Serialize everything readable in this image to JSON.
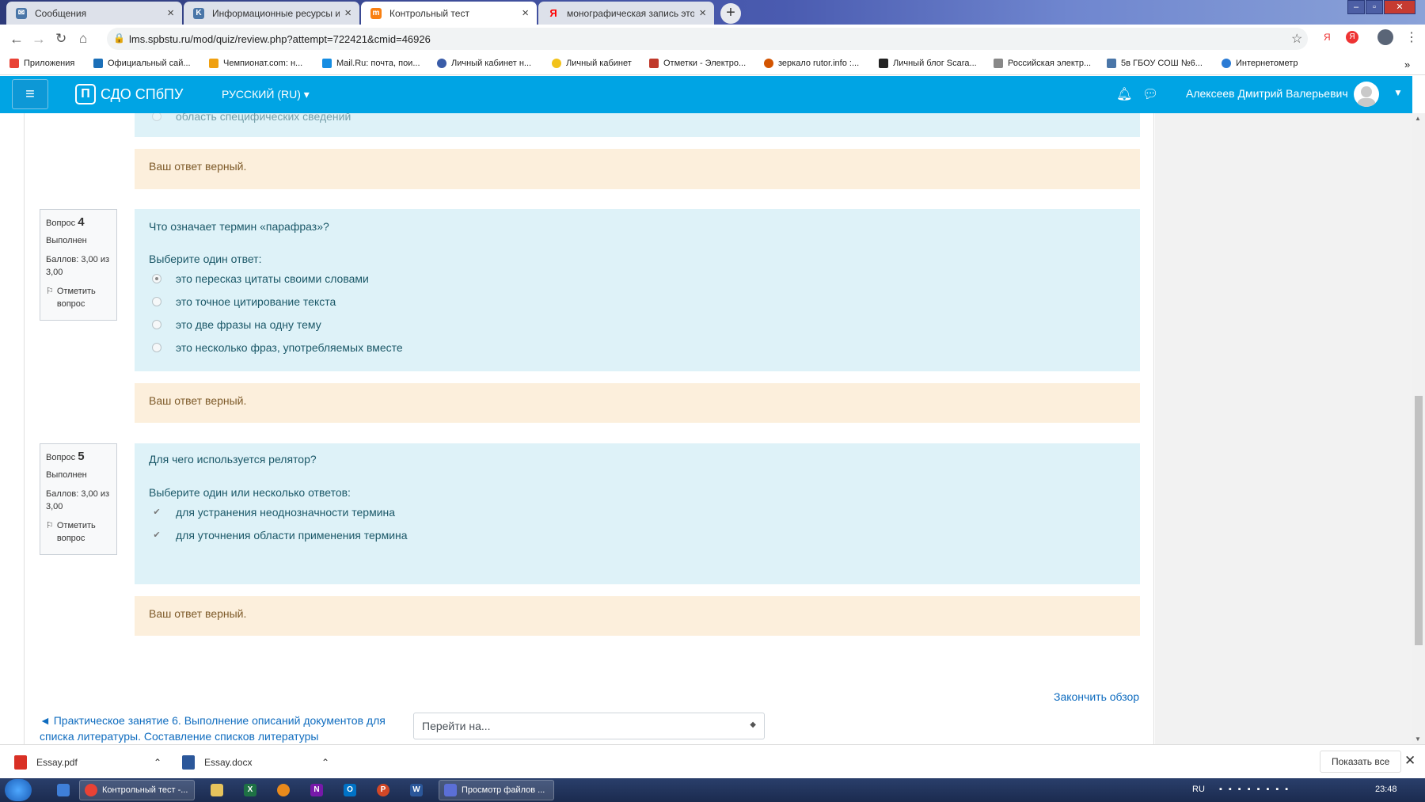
{
  "browser": {
    "tabs": [
      {
        "title": "Сообщения",
        "icon": "vk-message-icon",
        "color": "#4a76a8",
        "active": false
      },
      {
        "title": "Информационные ресурсы и т",
        "icon": "vk-icon",
        "color": "#4a76a8",
        "active": false
      },
      {
        "title": "Контрольный тест",
        "icon": "moodle-icon",
        "color": "#f98012",
        "active": true
      },
      {
        "title": "монографическая запись это —",
        "icon": "yandex-icon",
        "color": "#ff0000",
        "active": false
      }
    ],
    "url": "lms.spbstu.ru/mod/quiz/review.php?attempt=722421&cmid=46926",
    "bookmarks": [
      {
        "label": "Приложения",
        "color": "#e94235"
      },
      {
        "label": "Официальный сай...",
        "color": "#1b6fb8"
      },
      {
        "label": "Чемпионат.com: н...",
        "color": "#f0a010"
      },
      {
        "label": "Mail.Ru: почта, пои...",
        "color": "#168de2"
      },
      {
        "label": "Личный кабинет н...",
        "color": "#3a5ca8"
      },
      {
        "label": "Личный кабинет",
        "color": "#f2c21a"
      },
      {
        "label": "Отметки - Электро...",
        "color": "#c0392b"
      },
      {
        "label": "зеркало rutor.info :...",
        "color": "#d35400"
      },
      {
        "label": "Личный блог Scara...",
        "color": "#222222"
      },
      {
        "label": "Российская электр...",
        "color": "#888888"
      },
      {
        "label": "5в ГБОУ СОШ №6...",
        "color": "#4a76a8"
      },
      {
        "label": "Интернетометр",
        "color": "#2a7bd5"
      }
    ]
  },
  "header": {
    "site_name": "СДО СПбПУ",
    "language": "РУССКИЙ (RU) ▾",
    "user_name": "Алексеев Дмитрий Валерьевич"
  },
  "prev_question": {
    "partial_option": "область специфических сведений",
    "feedback": "Ваш ответ верный."
  },
  "questions": [
    {
      "label": "Вопрос",
      "number": "4",
      "state": "Выполнен",
      "score": "Баллов: 3,00 из 3,00",
      "flag": "Отметить вопрос",
      "text": "Что означает термин «парафраз»?",
      "prompt": "Выберите один ответ:",
      "options": [
        {
          "text": "это пересказ цитаты своими словами",
          "selected": true
        },
        {
          "text": "это точное цитирование текста",
          "selected": false
        },
        {
          "text": "это две фразы на одну тему",
          "selected": false
        },
        {
          "text": "это несколько фраз, употребляемых вместе",
          "selected": false
        }
      ],
      "feedback": "Ваш ответ верный."
    },
    {
      "label": "Вопрос",
      "number": "5",
      "state": "Выполнен",
      "score": "Баллов: 3,00 из 3,00",
      "flag": "Отметить вопрос",
      "text": "Для чего используется релятор?",
      "prompt": "Выберите один или несколько ответов:",
      "options": [
        {
          "text": "для устранения неоднозначности термина",
          "selected": true
        },
        {
          "text": "для уточнения области применения термина",
          "selected": true
        }
      ],
      "feedback": "Ваш ответ верный."
    }
  ],
  "footer": {
    "finish_review": "Закончить обзор",
    "prev_activity": "◄ Практическое занятие 6. Выполнение описаний документов для списка литературы. Составление списков литературы",
    "jump_placeholder": "Перейти на..."
  },
  "downloads": {
    "items": [
      {
        "name": "Essay.pdf",
        "color": "#d93025"
      },
      {
        "name": "Essay.docx",
        "color": "#2b579a"
      }
    ],
    "show_all": "Показать все"
  },
  "taskbar": {
    "items": [
      {
        "label": "Контрольный тест -...",
        "color": "#e94235"
      },
      {
        "label": "Просмотр файлов ...",
        "color": "#5b6fd6"
      }
    ],
    "lang": "RU",
    "time": "23:48"
  }
}
